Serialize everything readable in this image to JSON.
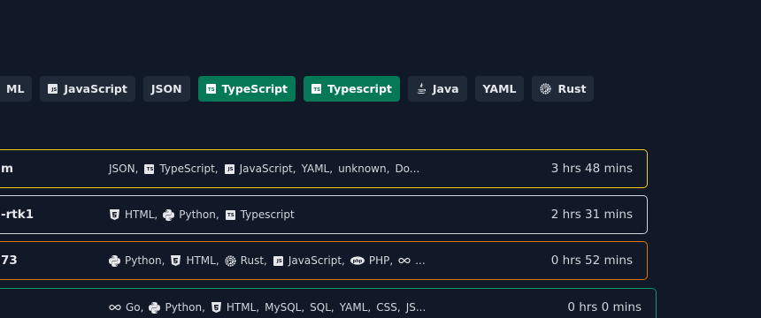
{
  "filters": [
    {
      "label": "ML",
      "icon": "html-icon",
      "active": false
    },
    {
      "label": "JavaScript",
      "icon": "js-icon",
      "active": false
    },
    {
      "label": "JSON",
      "icon": "",
      "active": false
    },
    {
      "label": "TypeScript",
      "icon": "ts-icon",
      "active": true
    },
    {
      "label": "Typescript",
      "icon": "ts-icon",
      "active": true
    },
    {
      "label": "Java",
      "icon": "java-icon",
      "active": false
    },
    {
      "label": "YAML",
      "icon": "",
      "active": false
    },
    {
      "label": "Rust",
      "icon": "rust-icon",
      "active": false
    }
  ],
  "rows": [
    {
      "name": "m",
      "border": "#facc15",
      "time": "3 hrs 48 mins",
      "langs": [
        {
          "label": "JSON",
          "icon": ""
        },
        {
          "label": "TypeScript",
          "icon": "ts-icon"
        },
        {
          "label": "JavaScript",
          "icon": "js-icon"
        },
        {
          "label": "YAML",
          "icon": ""
        },
        {
          "label": "unknown",
          "icon": ""
        },
        {
          "label": "Do...",
          "icon": ""
        }
      ]
    },
    {
      "name": "-rtk1",
      "border": "#d1d5db",
      "time": "2 hrs 31 mins",
      "langs": [
        {
          "label": "HTML",
          "icon": "html-icon"
        },
        {
          "label": "Python",
          "icon": "python-icon"
        },
        {
          "label": "Typescript",
          "icon": "ts-icon"
        }
      ]
    },
    {
      "name": "73",
      "border": "#d97706",
      "time": "0 hrs 52 mins",
      "langs": [
        {
          "label": "Python",
          "icon": "python-icon"
        },
        {
          "label": "HTML",
          "icon": "html-icon"
        },
        {
          "label": "Rust",
          "icon": "rust-icon"
        },
        {
          "label": "JavaScript",
          "icon": "js-icon"
        },
        {
          "label": "PHP",
          "icon": "php-icon"
        },
        {
          "label": "...",
          "icon": "infinity-icon"
        }
      ]
    },
    {
      "name": "",
      "border": "#059669",
      "time": "0 hrs 0 mins",
      "langs": [
        {
          "label": "Go",
          "icon": "infinity-icon"
        },
        {
          "label": "Python",
          "icon": "python-icon"
        },
        {
          "label": "HTML",
          "icon": "html-icon"
        },
        {
          "label": "MySQL",
          "icon": ""
        },
        {
          "label": "SQL",
          "icon": ""
        },
        {
          "label": "YAML",
          "icon": ""
        },
        {
          "label": "CSS",
          "icon": ""
        },
        {
          "label": "JS...",
          "icon": ""
        }
      ]
    }
  ]
}
